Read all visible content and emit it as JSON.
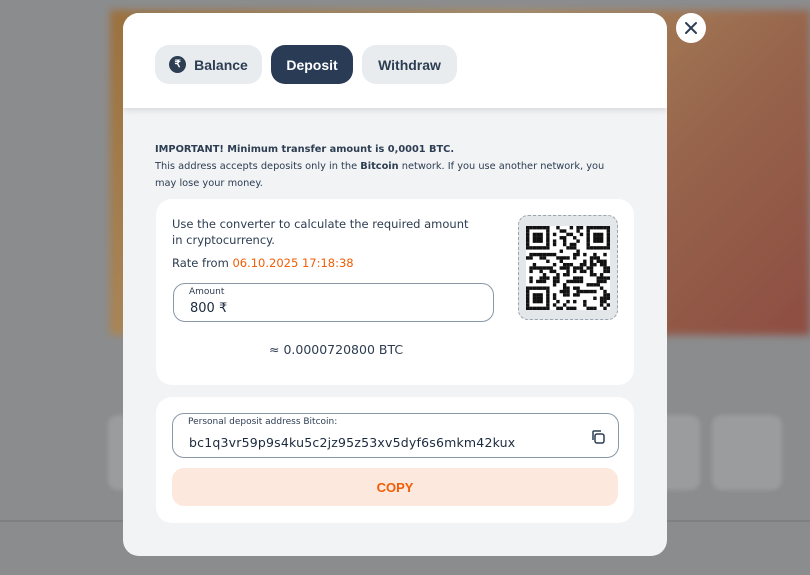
{
  "tabs": {
    "balance": "Balance",
    "deposit": "Deposit",
    "withdraw": "Withdraw",
    "active": "Deposit",
    "balance_icon": "₹"
  },
  "notice": {
    "important": "IMPORTANT! Minimum transfer amount is 0,0001 BTC.",
    "line_prefix": "This address accepts deposits only in the ",
    "network": "Bitcoin",
    "line_suffix": " network. If you use another network, you may lose your money."
  },
  "converter": {
    "text": "Use the converter to calculate the required amount in cryptocurrency.",
    "rate_label": "Rate from ",
    "rate_date": "06.10.2025 17:18:38",
    "amount_label": "Amount",
    "amount_value": "800 ₹",
    "approx_value": "≈  0.0000720800 BTC"
  },
  "address": {
    "label": "Personal deposit address Bitcoin:",
    "value": "bc1q3vr59p9s4ku5c2jz95z53xv5dyf6s6mkm42kux",
    "copy_label": "COPY"
  },
  "colors": {
    "accent": "#f25c05",
    "tab_active": "#293b55",
    "text": "#2d3d52"
  }
}
